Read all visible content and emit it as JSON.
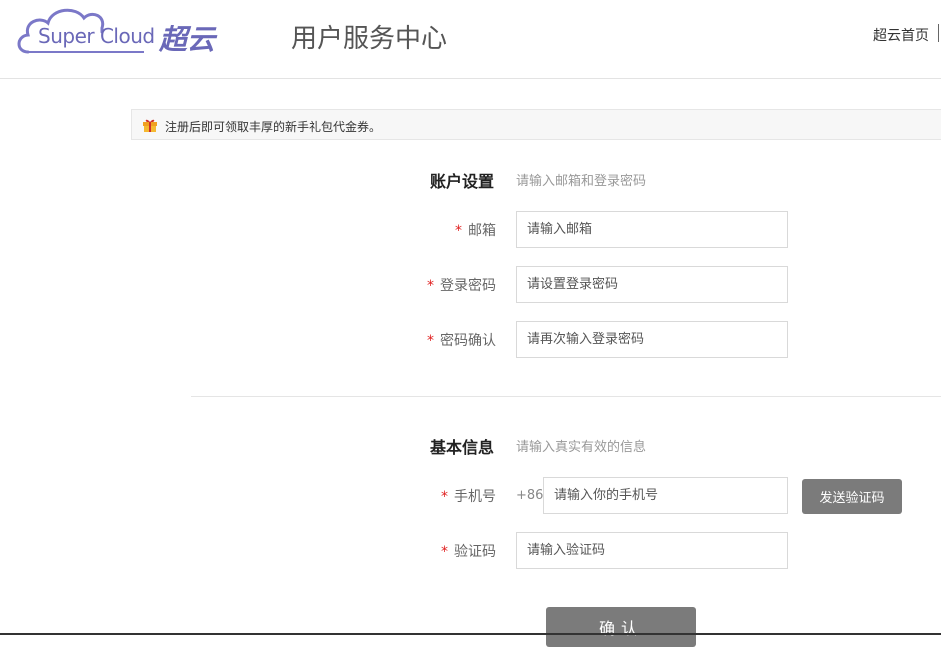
{
  "header": {
    "logo_text": "Super Cloud",
    "logo_cn": "超云",
    "title": "用户服务中心",
    "home_link": "超云首页"
  },
  "notice": {
    "icon": "gift-icon",
    "text": "注册后即可领取丰厚的新手礼包代金券。"
  },
  "account": {
    "title": "账户设置",
    "hint": "请输入邮箱和登录密码",
    "fields": [
      {
        "label": "邮箱",
        "placeholder": "请输入邮箱"
      },
      {
        "label": "登录密码",
        "placeholder": "请设置登录密码"
      },
      {
        "label": "密码确认",
        "placeholder": "请再次输入登录密码"
      }
    ]
  },
  "basic": {
    "title": "基本信息",
    "hint": "请输入真实有效的信息",
    "phone_label": "手机号",
    "phone_prefix": "+86",
    "phone_placeholder": "请输入你的手机号",
    "send_code_label": "发送验证码",
    "code_label": "验证码",
    "code_placeholder": "请输入验证码"
  },
  "required_mark": "*",
  "confirm_label": "确认",
  "colors": {
    "brand": "#6a68b8",
    "button": "#7b7b7b",
    "required": "#e02020"
  }
}
